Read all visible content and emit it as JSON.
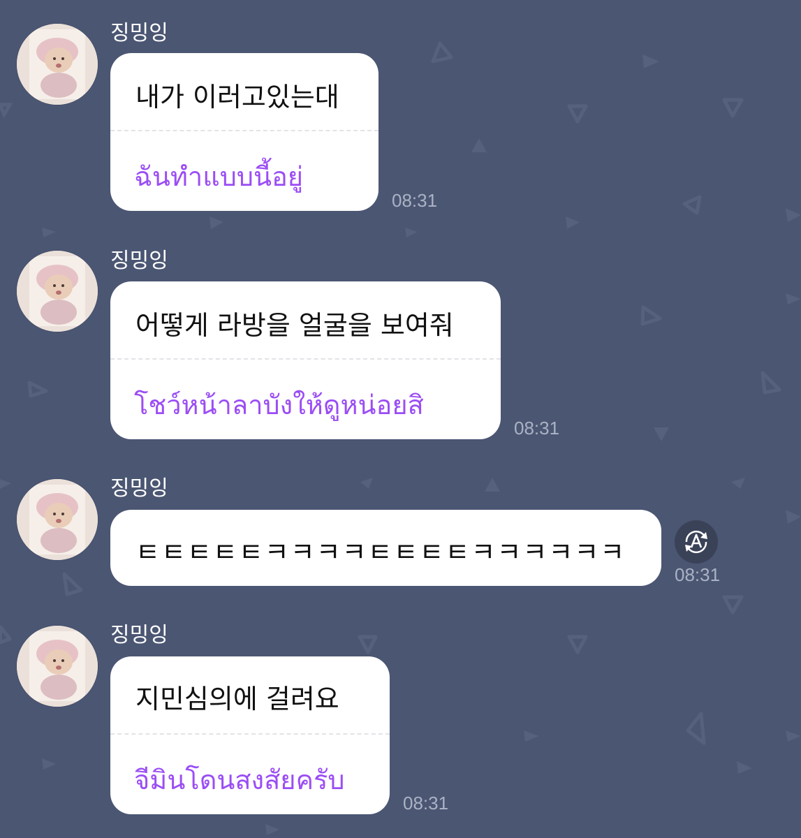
{
  "messages": [
    {
      "sender": "징밍잉",
      "original": "내가 이러고있는대",
      "translation": "ฉันทำแบบนี้อยู่",
      "time": "08:31"
    },
    {
      "sender": "징밍잉",
      "original": "어떻게 라방을 얼굴을 보여줘",
      "translation": "โชว์หน้าลาบังให้ดูหน่อยสิ",
      "time": "08:31"
    },
    {
      "sender": "징밍잉",
      "original": "ㅌㅌㅌㅌㅌㅋㅋㅋㅋㅌㅌㅌㅌㅋㅋㅋㅋㅋㅋ",
      "translation": "",
      "time": "08:31"
    },
    {
      "sender": "징밍잉",
      "original": "지민심의에 걸려요",
      "translation": "จีมินโดนสงสัยครับ",
      "time": "08:31"
    }
  ],
  "icons": {
    "translate": "translate-icon",
    "avatar": "avatar-photo"
  },
  "colors": {
    "background": "#4b5673",
    "bubble": "#ffffff",
    "translation_text": "#9b4df5",
    "timestamp": "#aab2c3"
  }
}
